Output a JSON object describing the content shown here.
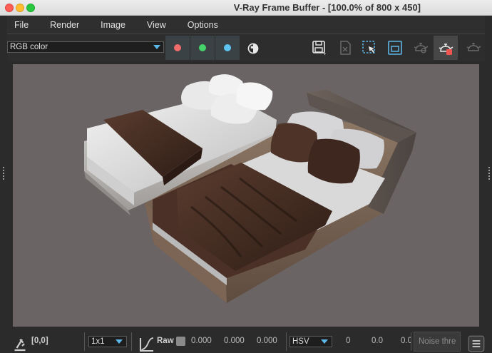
{
  "window": {
    "title": "V-Ray Frame Buffer - [100.0% of 800 x 450]"
  },
  "menu": {
    "items": [
      "File",
      "Render",
      "Image",
      "View",
      "Options"
    ]
  },
  "toolbar": {
    "channel_select": "RGB color",
    "channel_buttons": [
      {
        "name": "red-channel",
        "color": "#f26b6b"
      },
      {
        "name": "green-channel",
        "color": "#46d46a"
      },
      {
        "name": "blue-channel",
        "color": "#5cc4ef"
      }
    ],
    "icons": [
      "alpha-icon",
      "save-icon",
      "clear-icon",
      "region-render-icon",
      "track-mouse-icon",
      "interactive-render-icon",
      "render-icon",
      "teapot-icon"
    ]
  },
  "status": {
    "coords": "[0,0]",
    "sample_size": "1x1",
    "raw_label": "Raw",
    "rgb_values": [
      "0.000",
      "0.000",
      "0.000"
    ],
    "color_mode": "HSV",
    "hsv_values": [
      "0",
      "0.0",
      "0.0"
    ],
    "noise_label": "Noise thre"
  },
  "colors": {
    "accent": "#5cb8e8",
    "viewport_bg": "#6b6464"
  }
}
